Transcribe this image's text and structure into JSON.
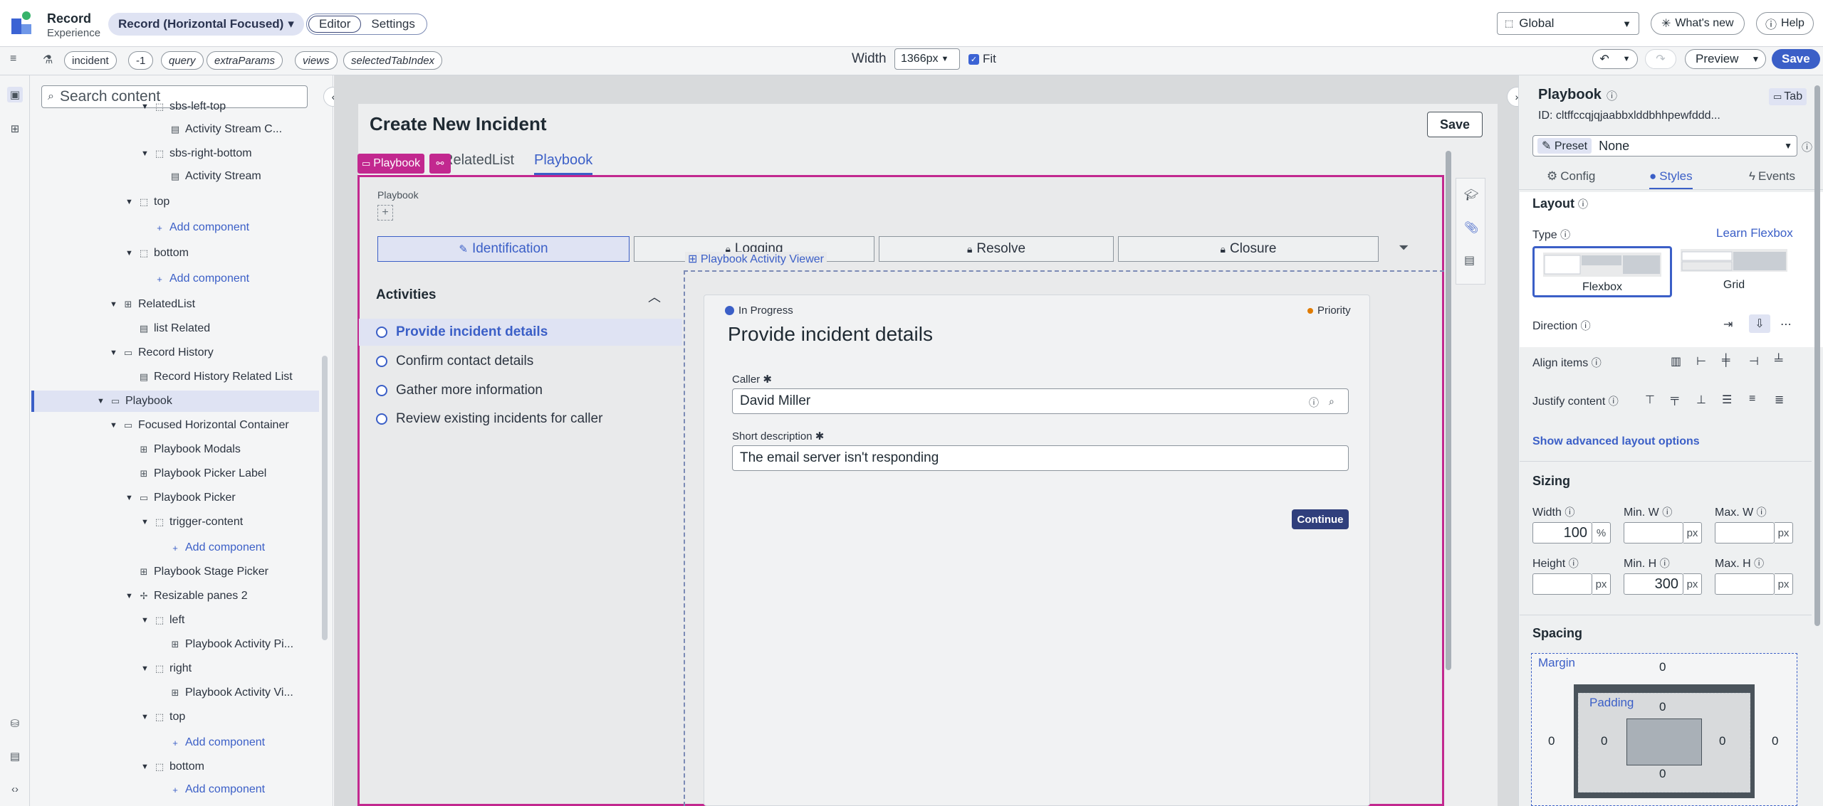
{
  "header": {
    "app_title": "Record",
    "app_subtitle": "Experience",
    "page_name": "Record (Horizontal Focused)",
    "modes": [
      "Editor",
      "Settings"
    ],
    "scope": "Global",
    "whats_new": "What's new",
    "help": "Help"
  },
  "toolbar": {
    "chips": [
      "incident",
      "-1",
      "query",
      "extraParams",
      "views",
      "selectedTabIndex"
    ],
    "width_label": "Width",
    "width_value": "1366px",
    "fit_label": "Fit",
    "preview": "Preview",
    "save": "Save"
  },
  "tree": {
    "search_placeholder": "Search content",
    "add_component": "Add component",
    "rows": [
      {
        "label": "sbs-left-top"
      },
      {
        "label": "Activity Stream C..."
      },
      {
        "label": "sbs-right-bottom"
      },
      {
        "label": "Activity Stream"
      },
      {
        "label": "top"
      },
      {
        "label": "Add component"
      },
      {
        "label": "bottom"
      },
      {
        "label": "Add component"
      },
      {
        "label": "RelatedList"
      },
      {
        "label": "list Related"
      },
      {
        "label": "Record History"
      },
      {
        "label": "Record History Related List"
      },
      {
        "label": "Playbook"
      },
      {
        "label": "Focused Horizontal Container"
      },
      {
        "label": "Playbook Modals"
      },
      {
        "label": "Playbook Picker Label"
      },
      {
        "label": "Playbook Picker"
      },
      {
        "label": "trigger-content"
      },
      {
        "label": "Add component"
      },
      {
        "label": "Playbook Stage Picker"
      },
      {
        "label": "Resizable panes 2"
      },
      {
        "label": "left"
      },
      {
        "label": "Playbook Activity Pi..."
      },
      {
        "label": "right"
      },
      {
        "label": "Playbook Activity Vi..."
      },
      {
        "label": "top"
      },
      {
        "label": "Add component"
      },
      {
        "label": "bottom"
      },
      {
        "label": "Add component"
      }
    ]
  },
  "canvas": {
    "title": "Create New Incident",
    "save": "Save",
    "tabs": [
      "RelatedList",
      "Playbook"
    ],
    "pill_label": "Playbook",
    "playbook_label": "Playbook",
    "stages": [
      "Identification",
      "Logging",
      "Resolve",
      "Closure"
    ],
    "activity_viewer_label": "Playbook Activity Viewer",
    "activities_title": "Activities",
    "activities": [
      "Provide incident details",
      "Confirm contact details",
      "Gather more information",
      "Review existing incidents for caller"
    ],
    "status": "In Progress",
    "priority": "Priority",
    "detail_title": "Provide incident details",
    "caller_label": "Caller",
    "caller_value": "David Miller",
    "short_desc_label": "Short description",
    "short_desc_value": "The email server isn't responding",
    "continue": "Continue"
  },
  "panel": {
    "title": "Playbook",
    "tab_badge": "Tab",
    "id": "ID: cltffccqjqjaabbxlddbhhpewfddd...",
    "preset_chip": "Preset",
    "preset_value": "None",
    "tabs": [
      "Config",
      "Styles",
      "Events"
    ],
    "layout": "Layout",
    "type": "Type",
    "learn_flexbox": "Learn Flexbox",
    "flexbox": "Flexbox",
    "grid": "Grid",
    "direction": "Direction",
    "align_items": "Align items",
    "justify_content": "Justify content",
    "advanced": "Show advanced layout options",
    "sizing": "Sizing",
    "width": "Width",
    "min_w": "Min. W",
    "max_w": "Max. W",
    "height": "Height",
    "min_h": "Min. H",
    "max_h": "Max. H",
    "width_value": "100",
    "width_unit": "%",
    "min_h_value": "300",
    "px": "px",
    "spacing": "Spacing",
    "margin": "Margin",
    "padding": "Padding",
    "zero": "0"
  },
  "colors": {
    "accent": "#3b5fc7",
    "highlight": "#c2288f"
  }
}
